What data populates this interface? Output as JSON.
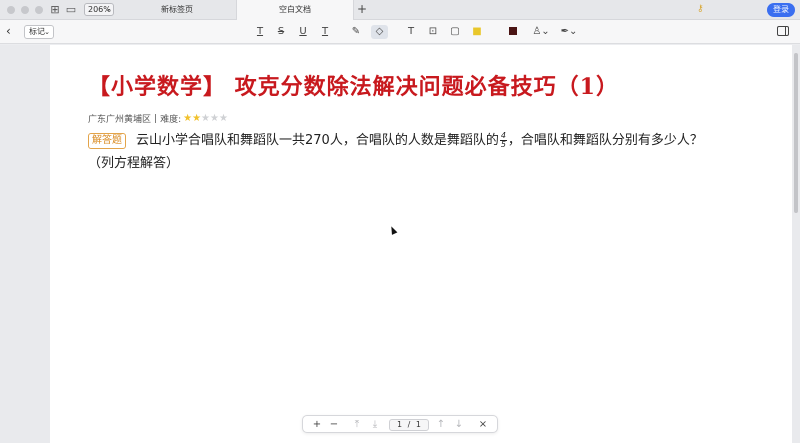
{
  "window": {
    "zoom": "206%",
    "tabs": [
      {
        "label": "新标签页"
      },
      {
        "label": "空白文档"
      }
    ],
    "login_label": "登录"
  },
  "toolbar": {
    "mark_label": "标记",
    "tools": [
      "underline-wavy-icon",
      "strikethrough-icon",
      "underline-icon",
      "text-insert-icon",
      "highlighter-icon",
      "eraser-icon",
      "text-icon",
      "textbox-icon",
      "callout-icon",
      "sticky-note-icon",
      "color-picker-icon",
      "stamp-icon",
      "pen-icon"
    ],
    "color_swatch": "#4a1414"
  },
  "document": {
    "title": "【小学数学】 攻克分数除法解决问题必备技巧（1）",
    "title_color": "#c8191e",
    "meta_region": "广东广州黄埔区",
    "meta_sep": "|",
    "difficulty_label": "难度:",
    "difficulty": 2,
    "difficulty_max": 5,
    "question_badge": "解答题",
    "question_part1": "云山小学合唱队和舞蹈队一共270人，合唱队的人数是舞蹈队的",
    "fraction": {
      "numerator": "4",
      "denominator": "5"
    },
    "question_part2": "，合唱队和舞蹈队分别有多少人？（列方程解答）"
  },
  "bottombar": {
    "zoom_in": "+",
    "zoom_out": "−",
    "page_current": "1",
    "page_sep": "/",
    "page_total": "1",
    "close": "×"
  }
}
